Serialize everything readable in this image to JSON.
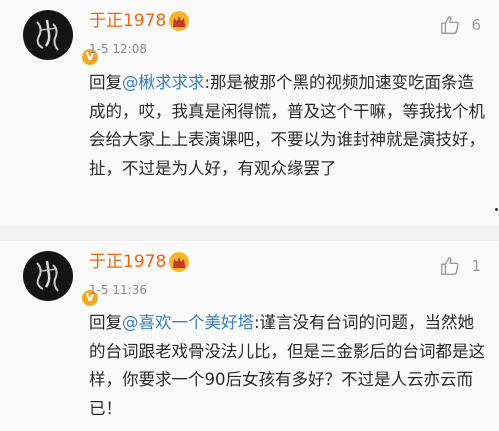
{
  "comments": [
    {
      "username": "于正1978",
      "time": "1-5 12:08",
      "likes": "6",
      "reply_prefix": "回复",
      "mention": "@楸求求求",
      "text": ":那是被那个黑的视频加速变吃面条造成的，哎，我真是闲得慌，普及这个干嘛，等我找个机会给大家上上表演课吧，不要以为谁封神就是演技好，扯，不过是为人好，有观众缘罢了"
    },
    {
      "username": "于正1978",
      "time": "1-5 11:36",
      "likes": "1",
      "reply_prefix": "回复",
      "mention": "@喜欢一个美好塔",
      "text": ":谨言没有台词的问题，当然她的台词跟老戏骨没法儿比，但是三金影后的台词都是这样，你要求一个90后女孩有多好？不过是人云亦云而已！"
    }
  ],
  "icons": {
    "like": "thumbs-up-icon",
    "verified": "verified-badge-icon",
    "crown": "crown-icon"
  },
  "colors": {
    "username": "#e8680f",
    "mention": "#3a7dbd",
    "time": "#8a8a8a"
  }
}
